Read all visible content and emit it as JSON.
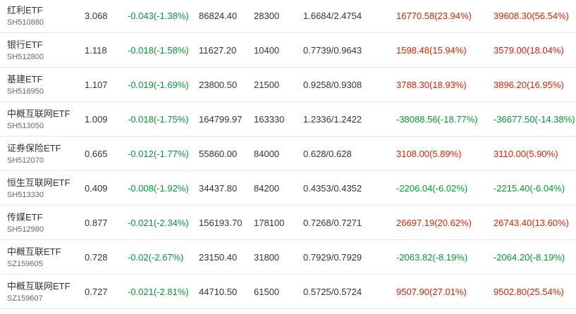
{
  "colors": {
    "up": "#dd2200",
    "down": "#009933",
    "text": "#333333",
    "muted": "#666666",
    "border": "#e8e8e8"
  },
  "rows": [
    {
      "name": "红利ETF",
      "code": "SH510880",
      "price": "3.068",
      "change": "-0.043(-1.38%)",
      "amount": "86824.40",
      "shares": "28300",
      "cost": "1.6684/2.4754",
      "profit": "16770.58(23.94%)",
      "total": "39608.30(56.54%)",
      "profit_dir": "up",
      "total_dir": "up"
    },
    {
      "name": "银行ETF",
      "code": "SH512800",
      "price": "1.118",
      "change": "-0.018(-1.58%)",
      "amount": "11627.20",
      "shares": "10400",
      "cost": "0.7739/0.9643",
      "profit": "1598.48(15.94%)",
      "total": "3579.00(18.04%)",
      "profit_dir": "up",
      "total_dir": "up"
    },
    {
      "name": "基建ETF",
      "code": "SH516950",
      "price": "1.107",
      "change": "-0.019(-1.69%)",
      "amount": "23800.50",
      "shares": "21500",
      "cost": "0.9258/0.9308",
      "profit": "3788.30(18.93%)",
      "total": "3896.20(16.95%)",
      "profit_dir": "up",
      "total_dir": "up"
    },
    {
      "name": "中概互联网ETF",
      "code": "SH513050",
      "price": "1.009",
      "change": "-0.018(-1.75%)",
      "amount": "164799.97",
      "shares": "163330",
      "cost": "1.2336/1.2422",
      "profit": "-38088.56(-18.77%)",
      "total": "-36677.50(-14.38%)",
      "profit_dir": "down",
      "total_dir": "down"
    },
    {
      "name": "证券保险ETF",
      "code": "SH512070",
      "price": "0.665",
      "change": "-0.012(-1.77%)",
      "amount": "55860.00",
      "shares": "84000",
      "cost": "0.628/0.628",
      "profit": "3108.00(5.89%)",
      "total": "3110.00(5.90%)",
      "profit_dir": "up",
      "total_dir": "up"
    },
    {
      "name": "恒生互联网ETF",
      "code": "SH513330",
      "price": "0.409",
      "change": "-0.008(-1.92%)",
      "amount": "34437.80",
      "shares": "84200",
      "cost": "0.4353/0.4352",
      "profit": "-2206.04(-6.02%)",
      "total": "-2215.40(-6.04%)",
      "profit_dir": "down",
      "total_dir": "down"
    },
    {
      "name": "传媒ETF",
      "code": "SH512980",
      "price": "0.877",
      "change": "-0.021(-2.34%)",
      "amount": "156193.70",
      "shares": "178100",
      "cost": "0.7268/0.7271",
      "profit": "26697.19(20.62%)",
      "total": "26743.40(13.60%)",
      "profit_dir": "up",
      "total_dir": "up"
    },
    {
      "name": "中概互联ETF",
      "code": "SZ159605",
      "price": "0.728",
      "change": "-0.02(-2.67%)",
      "amount": "23150.40",
      "shares": "31800",
      "cost": "0.7929/0.7929",
      "profit": "-2063.82(-8.19%)",
      "total": "-2064.20(-8.19%)",
      "profit_dir": "down",
      "total_dir": "down"
    },
    {
      "name": "中概互联网ETF",
      "code": "SZ159607",
      "price": "0.727",
      "change": "-0.021(-2.81%)",
      "amount": "44710.50",
      "shares": "61500",
      "cost": "0.5725/0.5724",
      "profit": "9507.90(27.01%)",
      "total": "9502.80(25.54%)",
      "profit_dir": "up",
      "total_dir": "up"
    }
  ]
}
